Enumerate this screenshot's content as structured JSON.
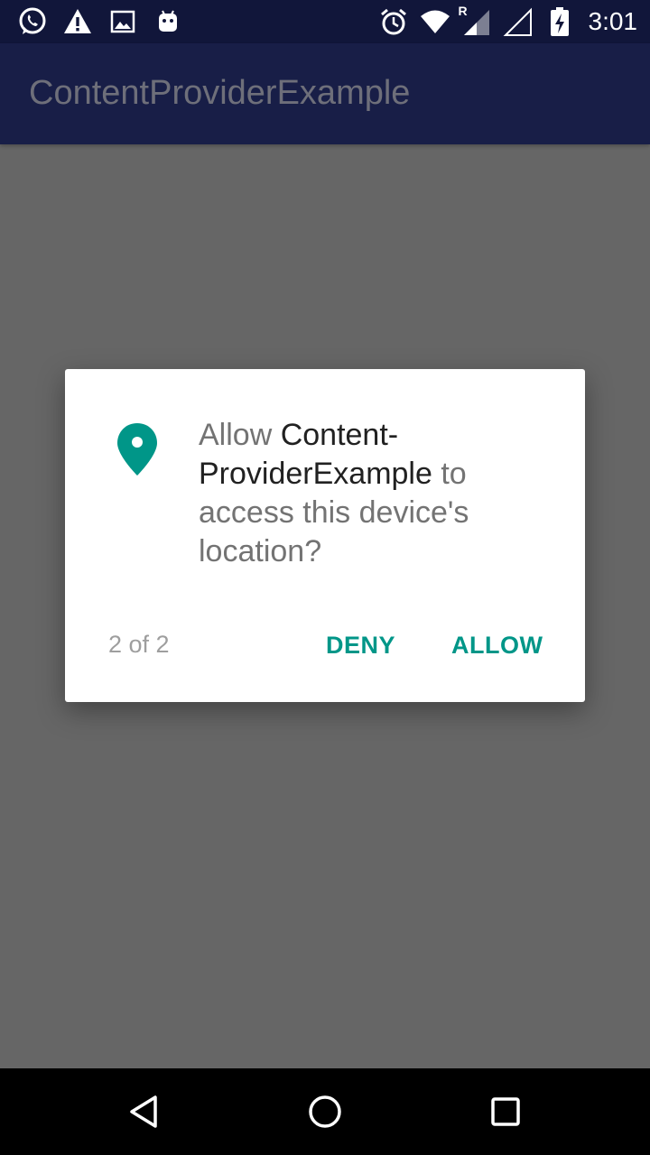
{
  "status_bar": {
    "time": "3:01",
    "left_icons": [
      "whatsapp-icon",
      "warning-icon",
      "image-icon",
      "android-icon"
    ],
    "right_icons": [
      "alarm-icon",
      "wifi-icon",
      "signal-roaming-icon",
      "signal-empty-icon",
      "battery-charging-icon"
    ],
    "roaming_letter": "R"
  },
  "app_bar": {
    "title": "ContentProviderExample"
  },
  "dialog": {
    "icon": "location-pin-icon",
    "message_prefix": "Allow ",
    "app_name": "Content-ProviderExample",
    "message_suffix": " to access this device's location?",
    "counter": "2 of 2",
    "deny_label": "DENY",
    "allow_label": "ALLOW"
  },
  "nav_bar": {
    "buttons": [
      "back-icon",
      "home-icon",
      "recents-icon"
    ]
  },
  "colors": {
    "status_bar_bg": "#11163a",
    "app_bar_bg": "#181e47",
    "scrim": "#666666",
    "accent": "#009688",
    "dialog_bg": "#ffffff",
    "nav_bar_bg": "#000000"
  }
}
